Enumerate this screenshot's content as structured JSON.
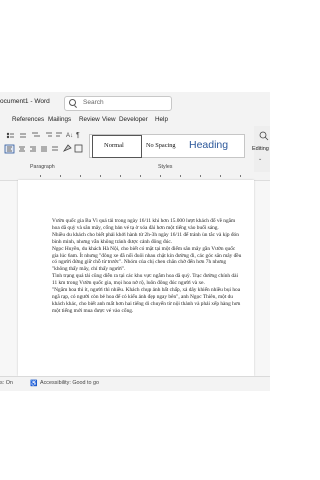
{
  "window": {
    "title": "ocument1 - Word"
  },
  "search": {
    "placeholder": "Search"
  },
  "menu": [
    "References",
    "Mailings",
    "Review",
    "View",
    "Developer",
    "Help"
  ],
  "styles": {
    "normal": "Normal",
    "no_spacing": "No Spacing",
    "heading": "Heading",
    "editing": "Editing"
  },
  "groups": {
    "paragraph": "Paragraph",
    "styles": "Styles"
  },
  "document": {
    "paragraphs": [
      "Vườn quốc gia Ba Vì quá tải trong ngày 16/11 khi hơn 15.000 lượt khách đổ về ngắm hoa dã quỳ và săn mây, cổng bản vé tạ ờ xóa đài hơn một tiếng vào buổi sáng.",
      "Nhiều du khách cho biết phải khởi hành từ 2h-3h ngày 16/11 để tránh ùn tắc và kịp đón bình minh, nhưng vẫn không tránh được cảnh đông đúc.",
      "Ngọc Huyền, du khách Hà Nội, cho biết có mặt tại một điểm săn mây gần Vườn quốc gia lúc 6am. Ít nhưng \"đông xe đã nối đuôi nhau chật kín đường đi, các góc săn mây đều có người đứng giữ chỗ từ trước\". Nhóm của chị chen chân chờ đến hơn 7h nhưng \"không thấy mây, chỉ thấy người\".",
      "Tình trạng quá tải cũng diễn ra tại các khu vực ngắm hoa dã quỳ. Trạc đường chính dài 11 km trong Vườn quốc gia, mọi hoa nở rộ, luôn đông đúc người và xe.",
      "\"Ngắm hoa thì ít, người thì nhiều. Khách chụp ảnh bất chấp, xả dây khiến nhiều bụi hoa ngã rạp, có người còn bẻ hoa để có kiểu ảnh đẹp ngay bên\", anh Ngọc Thiên, một du khách khác, cho biết anh mất hơn hai tiếng di chuyển từ nội thành và phải xếp hàng hơn một tiếng mới mua được vé vào cổng."
    ]
  },
  "status": {
    "left": "s: On",
    "accessibility": "Accessibility: Good to go"
  },
  "colors": {
    "accent": "#2b579a",
    "chrome": "#f3f3f3"
  }
}
